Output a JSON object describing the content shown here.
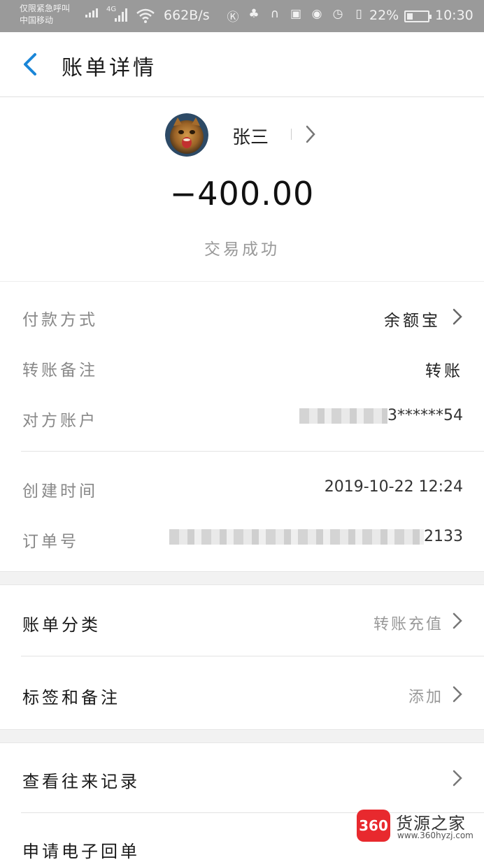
{
  "status_bar": {
    "carrier_line1": "仅限紧急呼叫",
    "carrier_line2": "中国移动",
    "network": "4G",
    "speed": "662B/s",
    "battery": "22%",
    "time": "10:30"
  },
  "nav": {
    "title": "账单详情"
  },
  "payee": {
    "name": "张三"
  },
  "amount": "−400.00",
  "status": "交易成功",
  "details": [
    {
      "label": "付款方式",
      "value": "余额宝"
    },
    {
      "label": "转账备注",
      "value": "转账"
    },
    {
      "label": "对方账户",
      "value": "3******54"
    },
    {
      "label": "创建时间",
      "value": "2019-10-22 12:24"
    },
    {
      "label": "订单号",
      "value": "2133"
    }
  ],
  "menu": [
    {
      "label": "账单分类",
      "value": "转账充值"
    },
    {
      "label": "标签和备注",
      "value": "添加"
    },
    {
      "label": "查看往来记录",
      "value": ""
    },
    {
      "label": "申请电子回单",
      "value": ""
    }
  ],
  "watermark": {
    "logo": "360",
    "name": "货源之家",
    "url": "www.360hyzj.com"
  },
  "colors": {
    "accent": "#1a86d8",
    "status_bar": "#9a9a9a",
    "band": "#f2f2f2"
  }
}
